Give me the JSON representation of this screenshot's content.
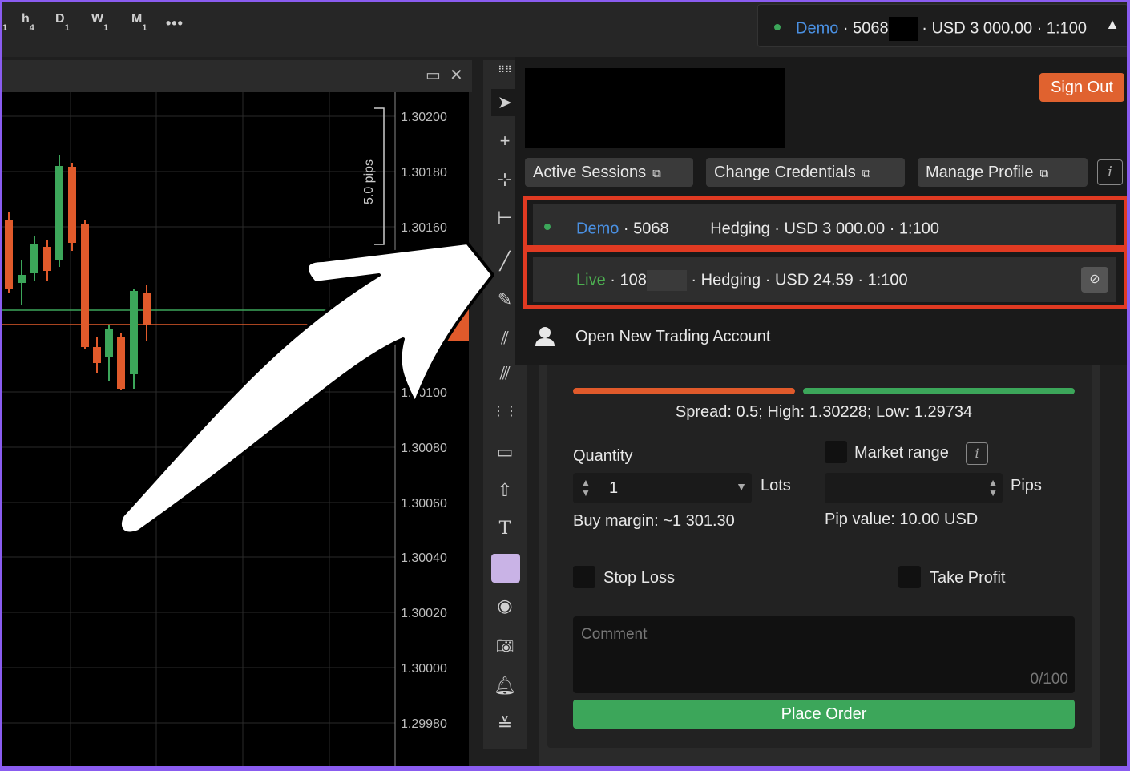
{
  "topbar": {
    "timeframes": [
      {
        "letter": "h",
        "num": "4"
      },
      {
        "letter": "D",
        "num": "1"
      },
      {
        "letter": "W",
        "num": "1"
      },
      {
        "letter": "M",
        "num": "1"
      }
    ],
    "edge_sub": "1",
    "more": "•••",
    "account": {
      "type": "Demo",
      "number": "5068",
      "sep": "·",
      "balance": "USD 3 000.00",
      "leverage": "1:100",
      "caret": "▲"
    }
  },
  "chart": {
    "price_labels": [
      "1.30200",
      "1.30180",
      "1.30160",
      "1.30100",
      "1.30080",
      "1.30060",
      "1.30040",
      "1.30020",
      "1.30000",
      "1.29980"
    ],
    "pips_annotation": "5.0 pips",
    "window_buttons": {
      "maximize": "🗖",
      "close": "✕"
    }
  },
  "dropdown": {
    "sign_out": "Sign Out",
    "buttons": [
      "Active Sessions",
      "Change Credentials",
      "Manage Profile"
    ],
    "info": "i",
    "accounts": [
      {
        "type": "Demo",
        "number": "5068",
        "mode": "Hedging",
        "balance": "USD 3 000.00",
        "leverage": "1:100"
      },
      {
        "type": "Live",
        "number": "108",
        "mode": "Hedging",
        "balance": "USD 24.59",
        "leverage": "1:100"
      }
    ],
    "open_new": "Open New Trading Account"
  },
  "order": {
    "stats": "Spread: 0.5; High: 1.30228; Low: 1.29734",
    "quantity_label": "Quantity",
    "quantity_value": "1",
    "lots_label": "Lots",
    "market_range_label": "Market range",
    "pips_label": "Pips",
    "buy_margin": "Buy margin: ~1 301.30",
    "pip_value": "Pip value: 10.00 USD",
    "stop_loss": "Stop Loss",
    "take_profit": "Take Profit",
    "comment_placeholder": "Comment",
    "comment_count": "0/100",
    "place_order": "Place Order"
  },
  "colors": {
    "accent_orange": "#e0622f",
    "highlight_red": "#e03a22",
    "green": "#3ca65a",
    "blue": "#4a90e2",
    "candle_green": "#3ca65a",
    "candle_red": "#e05a2b"
  }
}
